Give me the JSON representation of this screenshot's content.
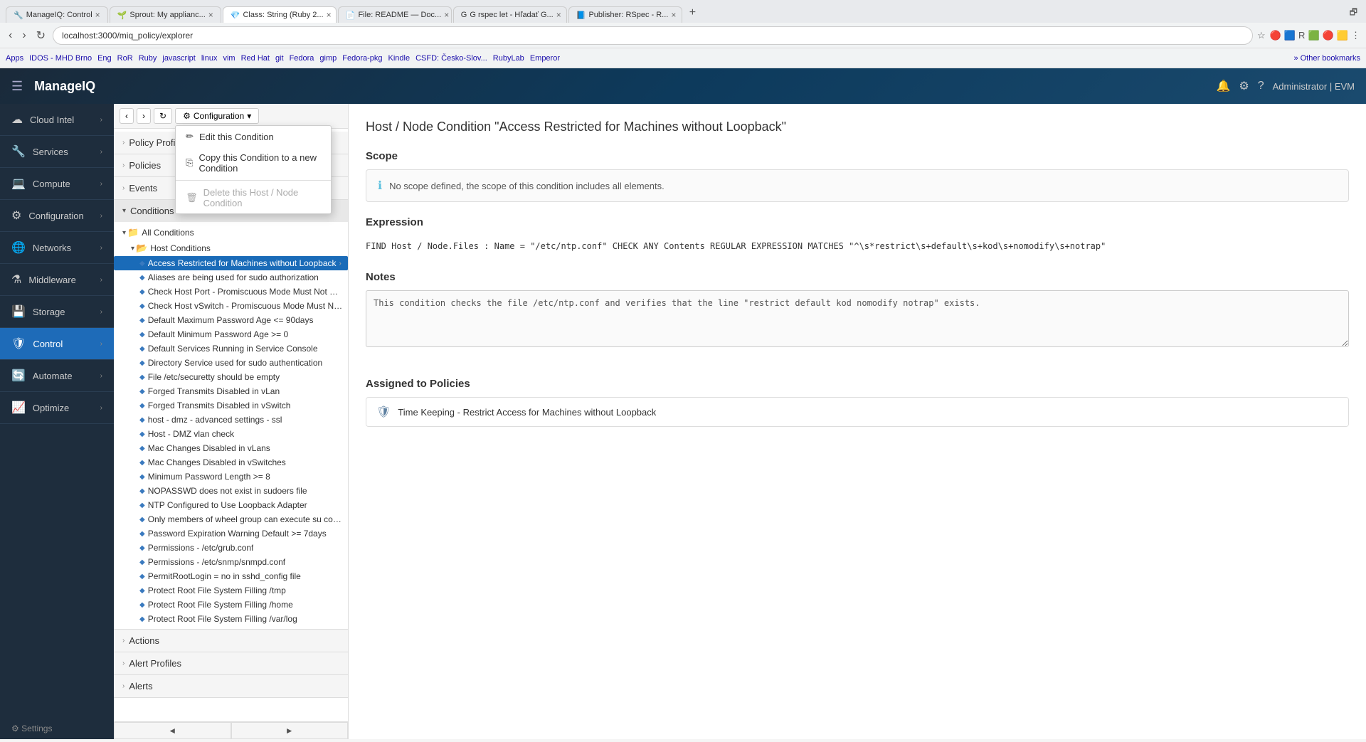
{
  "browser": {
    "tabs": [
      {
        "id": "tab1",
        "label": "ManageIQ: Control",
        "active": false,
        "favicon": "🔧"
      },
      {
        "id": "tab2",
        "label": "Sprout: My applianc...",
        "active": false,
        "favicon": "🌱"
      },
      {
        "id": "tab3",
        "label": "Class: String (Ruby 2...",
        "active": true,
        "favicon": "💎"
      },
      {
        "id": "tab4",
        "label": "File: README — Doc...",
        "active": false,
        "favicon": "📄"
      },
      {
        "id": "tab5",
        "label": "G rspec let - Hľadať G...",
        "active": false,
        "favicon": "G"
      },
      {
        "id": "tab6",
        "label": "Publisher: RSpec - R...",
        "active": false,
        "favicon": "📘"
      }
    ],
    "address": "localhost:3000/miq_policy/explorer",
    "bookmarks": [
      "Apps",
      "IDOS - MHD Brno",
      "Eng",
      "RoR",
      "Ruby",
      "javascript",
      "linux",
      "vim",
      "Red Hat",
      "git",
      "Fedora",
      "gimp",
      "Fedora-pkg",
      "Kindle",
      "CSFD: Česko-Slov...",
      "RubyLab",
      "Emperor",
      "Other bookmarks"
    ]
  },
  "topnav": {
    "app_name": "ManageIQ",
    "user_label": "Administrator | EVM"
  },
  "sidebar": {
    "items": [
      {
        "id": "cloud-intel",
        "label": "Cloud Intel",
        "icon": "☁"
      },
      {
        "id": "services",
        "label": "Services",
        "icon": "🔧"
      },
      {
        "id": "compute",
        "label": "Compute",
        "icon": "💻"
      },
      {
        "id": "configuration",
        "label": "Configuration",
        "icon": "⚙"
      },
      {
        "id": "networks",
        "label": "Networks",
        "icon": "🌐"
      },
      {
        "id": "middleware",
        "label": "Middleware",
        "icon": "⚗"
      },
      {
        "id": "storage",
        "label": "Storage",
        "icon": "💾"
      },
      {
        "id": "control",
        "label": "Control",
        "icon": "🛡",
        "active": true
      },
      {
        "id": "automate",
        "label": "Automate",
        "icon": "🔄"
      },
      {
        "id": "optimize",
        "label": "Optimize",
        "icon": "📈"
      }
    ]
  },
  "tree_toolbar": {
    "back_label": "‹",
    "forward_label": "›",
    "refresh_label": "↻",
    "config_label": "Configuration",
    "config_icon": "⚙",
    "dropdown_arrow": "▾"
  },
  "dropdown_menu": {
    "items": [
      {
        "id": "edit",
        "label": "Edit this Condition",
        "icon": "✏",
        "disabled": false
      },
      {
        "id": "copy",
        "label": "Copy this Condition to a new Condition",
        "icon": "⎘",
        "disabled": false
      },
      {
        "id": "delete",
        "label": "Delete this Host / Node Condition",
        "icon": "🗑",
        "disabled": true
      }
    ]
  },
  "left_panel": {
    "sections": [
      {
        "id": "policy-profiles",
        "label": "Policy Profiles",
        "expanded": false
      },
      {
        "id": "policies",
        "label": "Policies",
        "expanded": false
      },
      {
        "id": "events",
        "label": "Events",
        "expanded": false
      },
      {
        "id": "conditions",
        "label": "Conditions",
        "expanded": true
      }
    ],
    "bottom_sections": [
      {
        "id": "actions",
        "label": "Actions"
      },
      {
        "id": "alert-profiles",
        "label": "Alert Profiles"
      },
      {
        "id": "alerts",
        "label": "Alerts"
      }
    ]
  },
  "tree": {
    "all_conditions": {
      "label": "All Conditions",
      "expanded": true
    },
    "host_conditions": {
      "label": "Host Conditions",
      "expanded": true
    },
    "selected_item": "Access Restricted for Machines without Loopback",
    "items": [
      "Access Restricted for Machines without Loopback",
      "Aliases are being used for sudo authorization",
      "Check Host Port - Promiscuous Mode Must Not Be E...",
      "Check Host vSwitch - Promiscuous Mode Must Not B...",
      "Default Maximum Password Age <= 90days",
      "Default Minimum Password Age >= 0",
      "Default Services Running in Service Console",
      "Directory Service used for sudo authentication",
      "File /etc/securetty should be empty",
      "Forged Transmits Disabled in vLan",
      "Forged Transmits Disabled in vSwitch",
      "host - dmz - advanced settings - ssl",
      "Host - DMZ vlan check",
      "Mac Changes Disabled in vLans",
      "Mac Changes Disabled in vSwitches",
      "Minimum Password Length >= 8",
      "NOPASSWD does not exist in sudoers file",
      "NTP Configured to Use Loopback Adapter",
      "Only members of wheel group can execute su comm...",
      "Password Expiration Warning Default >= 7days",
      "Permissions - /etc/grub.conf",
      "Permissions - /etc/snmp/snmpd.conf",
      "PermitRootLogin = no in sshd_config file",
      "Protect Root File System Filling /tmp",
      "Protect Root File System Filling /home",
      "Protect Root File System Filling /var/log"
    ]
  },
  "detail": {
    "title": "Host / Node Condition \"Access Restricted for Machines without Loopback\"",
    "scope_heading": "Scope",
    "scope_info": "No scope defined, the scope of this condition includes all elements.",
    "expression_heading": "Expression",
    "expression_text": "FIND Host / Node.Files : Name = \"/etc/ntp.conf\" CHECK ANY Contents REGULAR EXPRESSION MATCHES \"^\\s*restrict\\s+default\\s+kod\\s+nomodify\\s+notrap\"",
    "notes_heading": "Notes",
    "notes_text": "This condition checks the file /etc/ntp.conf and verifies that the line \"restrict default kod nomodify notrap\" exists.",
    "assigned_heading": "Assigned to Policies",
    "assigned_policies": [
      {
        "label": "Time Keeping - Restrict Access for Machines without Loopback"
      }
    ]
  }
}
